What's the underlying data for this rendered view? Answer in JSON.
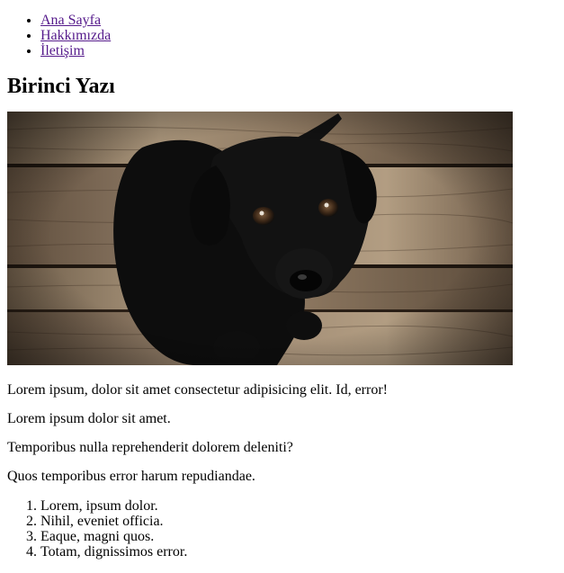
{
  "nav": {
    "items": [
      {
        "label": "Ana Sayfa"
      },
      {
        "label": "Hakkımızda"
      },
      {
        "label": "İletişim"
      }
    ]
  },
  "post": {
    "title": "Birinci Yazı",
    "image": {
      "icon": "puppy-photo"
    },
    "paragraphs": [
      "Lorem ipsum, dolor sit amet consectetur adipisicing elit. Id, error!",
      "Lorem ipsum dolor sit amet.",
      "Temporibus nulla reprehenderit dolorem deleniti?",
      "Quos temporibus error harum repudiandae."
    ],
    "list": [
      "Lorem, ipsum dolor.",
      "Nihil, eveniet officia.",
      "Eaque, magni quos.",
      "Totam, dignissimos error."
    ]
  }
}
